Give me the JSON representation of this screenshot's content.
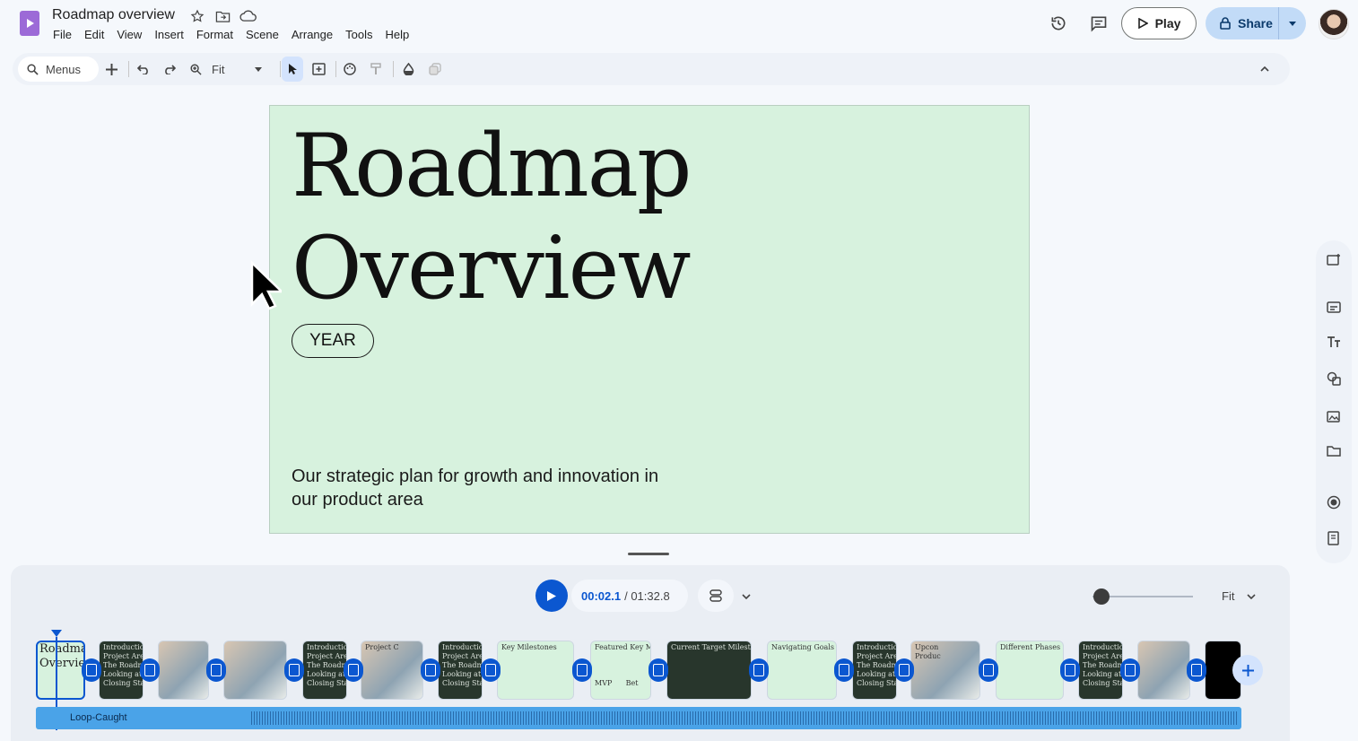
{
  "app": {
    "title": "Roadmap overview",
    "menu": [
      "File",
      "Edit",
      "View",
      "Insert",
      "Format",
      "Scene",
      "Arrange",
      "Tools",
      "Help"
    ],
    "play_label": "Play",
    "share_label": "Share",
    "accent": "#0b57d0"
  },
  "toolbar": {
    "search_label": "Menus",
    "zoom_value": "Fit"
  },
  "slide": {
    "title_line1": "Roadmap",
    "title_line2": "Overview",
    "year": "YEAR",
    "subtitle": "Our strategic plan for growth and innovation in our product area",
    "background": "#d7f2de"
  },
  "timeline": {
    "current_time": "00:02.1",
    "total_time": "/ 01:32.8",
    "zoom_label": "Fit",
    "audio_label": "Loop-Caught",
    "scenes": [
      {
        "style": "mint",
        "text": "Roadma\nOvervie"
      },
      {
        "style": "dark",
        "text": "Introductio\nProject Are\nThe Roadm\nLooking at\nClosing Sta"
      },
      {
        "style": "photo",
        "text": ""
      },
      {
        "style": "photo",
        "text": ""
      },
      {
        "style": "dark",
        "text": "Introductio\nProject Are\nThe Roadm\nLooking at\nClosing Sta"
      },
      {
        "style": "photo",
        "text": "Project C"
      },
      {
        "style": "dark",
        "text": "Introductio\nProject Are\nThe Roadm\nLooking at\nClosing Sta"
      },
      {
        "style": "mint",
        "text": "Key Milestones"
      },
      {
        "style": "mint",
        "text": "Featured Key Milestone\n\n\n\nMVP      Bet"
      },
      {
        "style": "dark",
        "text": "Current Target Milestones"
      },
      {
        "style": "mint",
        "text": "Navigating Goals"
      },
      {
        "style": "dark",
        "text": "Introductio\nProject Are\nThe Roadm\nLooking at\nClosing Sta"
      },
      {
        "style": "photo",
        "text": "Upcon\nProduc"
      },
      {
        "style": "mint",
        "text": "Different Phases"
      },
      {
        "style": "dark",
        "text": "Introductio\nProject Are\nThe Roadm\nLooking at\nClosing Sta"
      },
      {
        "style": "photo",
        "text": ""
      },
      {
        "style": "black",
        "text": ""
      }
    ]
  },
  "icons": [
    "star-icon",
    "folder-move-icon",
    "cloud-icon",
    "history-icon",
    "comment-icon",
    "lock-icon",
    "search-icon",
    "plus-icon",
    "undo-icon",
    "redo-icon",
    "zoom-icon",
    "pointer-icon",
    "text-box-icon",
    "palette-icon",
    "paint-format-icon",
    "fill-icon",
    "effects-icon",
    "collapse-icon",
    "scene-gen-icon",
    "caption-icon",
    "text-style-icon",
    "shapes-icon",
    "image-icon",
    "folder-icon",
    "record-icon",
    "notes-icon"
  ]
}
